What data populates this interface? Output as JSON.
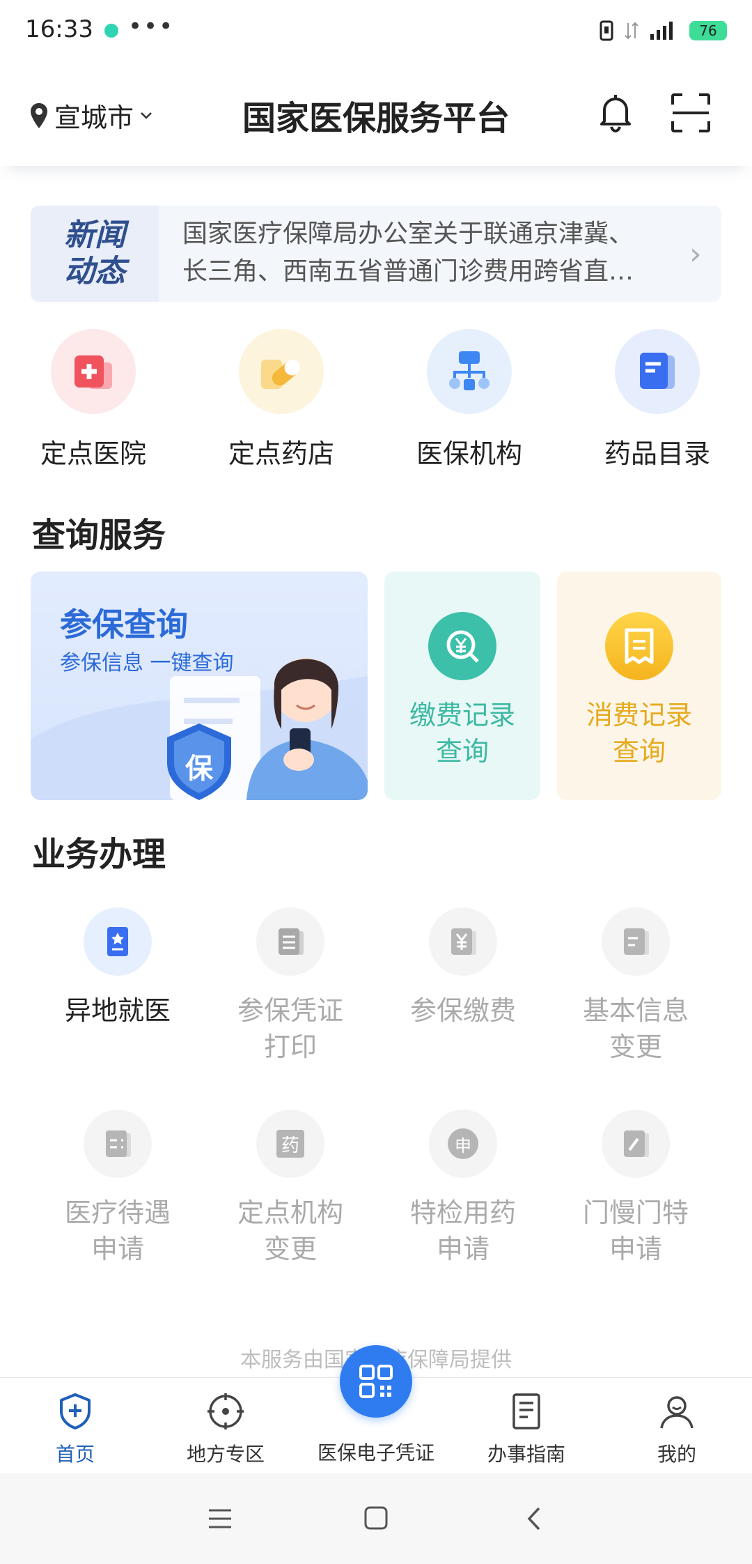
{
  "status": {
    "time": "16:33",
    "battery": "76"
  },
  "header": {
    "location": "宣城市",
    "title": "国家医保服务平台"
  },
  "news": {
    "tag_line1": "新闻",
    "tag_line2": "动态",
    "line1": "国家医疗保障局办公室关于联通京津冀、",
    "line2": "长三角、西南五省普通门诊费用跨省直…"
  },
  "quick": [
    {
      "label": "定点医院",
      "icon": "hospital-icon",
      "bg": "#fde8ea",
      "fg": "#f0525e"
    },
    {
      "label": "定点药店",
      "icon": "pill-icon",
      "bg": "#fdf4de",
      "fg": "#f5b83a"
    },
    {
      "label": "医保机构",
      "icon": "org-icon",
      "bg": "#e6f0fd",
      "fg": "#3c87f2"
    },
    {
      "label": "药品目录",
      "icon": "catalog-icon",
      "bg": "#e6edfd",
      "fg": "#3a6ef0"
    }
  ],
  "query": {
    "title": "查询服务",
    "main_title": "参保查询",
    "main_sub": "参保信息 一键查询",
    "badge": "保",
    "pay_line1": "缴费记录",
    "pay_line2": "查询",
    "spend_line1": "消费记录",
    "spend_line2": "查询",
    "pay_color": "#3db8a3",
    "spend_color": "#e6a91e"
  },
  "business": {
    "title": "业务办理",
    "items": [
      {
        "line1": "异地就医",
        "line2": "",
        "icon": "remote-medical-icon",
        "active": true
      },
      {
        "line1": "参保凭证",
        "line2": "打印",
        "icon": "print-icon",
        "active": false
      },
      {
        "line1": "参保缴费",
        "line2": "",
        "icon": "yuan-icon",
        "active": false
      },
      {
        "line1": "基本信息",
        "line2": "变更",
        "icon": "info-icon",
        "active": false
      },
      {
        "line1": "医疗待遇",
        "line2": "申请",
        "icon": "benefit-icon",
        "active": false
      },
      {
        "line1": "定点机构",
        "line2": "变更",
        "icon": "drug-icon",
        "glyph": "药",
        "active": false
      },
      {
        "line1": "特检用药",
        "line2": "申请",
        "icon": "apply-icon",
        "glyph": "申",
        "active": false
      },
      {
        "line1": "门慢门特",
        "line2": "申请",
        "icon": "edit-icon",
        "active": false
      }
    ]
  },
  "footer_note": "本服务由国家医疗保障局提供",
  "tabs": [
    {
      "label": "首页",
      "icon": "home-shield-icon",
      "active": true
    },
    {
      "label": "地方专区",
      "icon": "target-icon",
      "active": false
    },
    {
      "label": "医保电子凭证",
      "icon": "qr-icon",
      "active": false
    },
    {
      "label": "办事指南",
      "icon": "document-icon",
      "active": false
    },
    {
      "label": "我的",
      "icon": "user-icon",
      "active": false
    }
  ],
  "colors": {
    "accent": "#2f7bf0",
    "active_tab": "#1f5fb8"
  }
}
